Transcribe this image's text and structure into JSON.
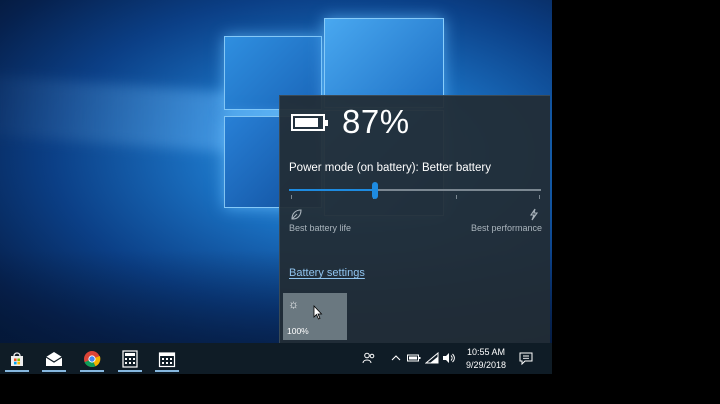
{
  "flyout": {
    "battery_percent_label": "87%",
    "battery_level": 0.87,
    "power_mode_label": "Power mode (on battery): Better battery",
    "slider_position": 0.34,
    "left_label": "Best battery life",
    "right_label": "Best performance",
    "battery_settings_link": "Battery settings",
    "brightness_tile": {
      "icon": "sun-icon",
      "value": "100%"
    }
  },
  "taskbar": {
    "pinned": [
      "store-icon",
      "mail-icon",
      "chrome-icon",
      "calculator-icon",
      "calendar-icon"
    ],
    "tray_icons": [
      "people-icon",
      "chevron-up-icon",
      "battery-icon",
      "wifi-icon",
      "volume-icon"
    ],
    "clock": {
      "time": "10:55 AM",
      "date": "9/29/2018"
    },
    "action_center_icon": "action-center-icon"
  },
  "colors": {
    "accent": "#1e8be0",
    "flyout_bg": "#222d35",
    "taskbar_bg": "#0f1c26",
    "link": "#8fc3ee"
  }
}
